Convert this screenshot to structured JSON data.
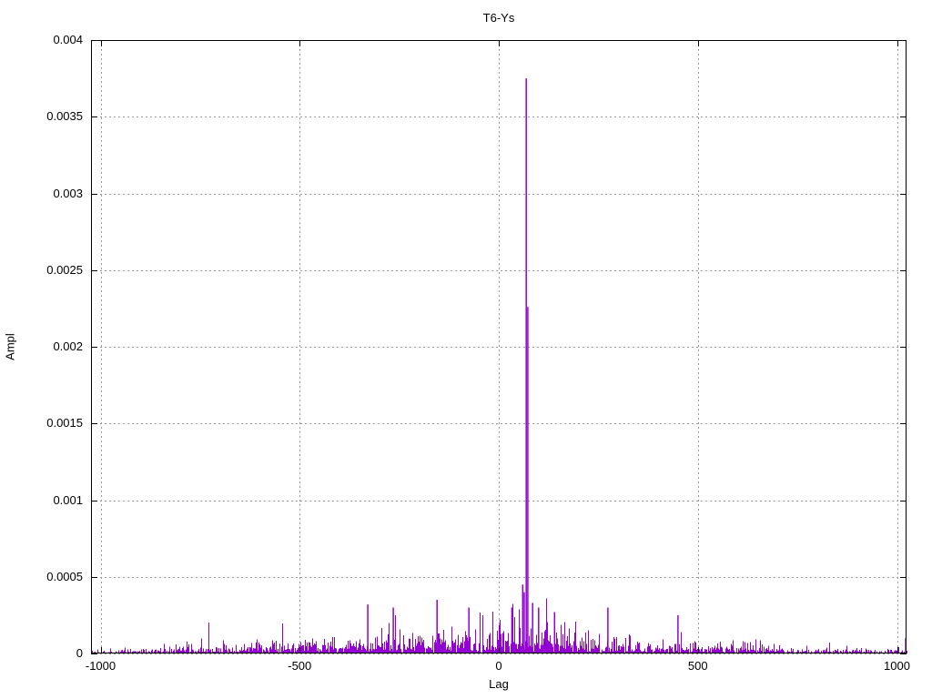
{
  "chart_data": {
    "type": "line",
    "style": "impulses",
    "title": "T6-Ys",
    "xlabel": "Lag",
    "ylabel": "Ampl",
    "xlim": [
      -1024,
      1024
    ],
    "ylim": [
      0,
      0.004
    ],
    "grid": true,
    "legend": "none",
    "series_color": "#9400d3",
    "grid_color": "#999999",
    "border_color": "#000000",
    "xticks": {
      "values": [
        -1000,
        -500,
        0,
        500,
        1000
      ],
      "labels": [
        "-1000",
        "-500",
        "0",
        "500",
        "1000"
      ]
    },
    "yticks": {
      "values": [
        0,
        0.0005,
        0.001,
        0.0015,
        0.002,
        0.0025,
        0.003,
        0.0035,
        0.004
      ],
      "labels": [
        "0",
        "0.0005",
        "0.001",
        "0.0015",
        "0.002",
        "0.0025",
        "0.003",
        "0.0035",
        "0.004"
      ]
    },
    "peaks": [
      {
        "lag": 69,
        "value": 0.00375
      },
      {
        "lag": 73,
        "value": 0.00226
      },
      {
        "lag": 60,
        "value": 0.00045
      },
      {
        "lag": 64,
        "value": 0.0004
      },
      {
        "lag": 33,
        "value": 0.0003
      },
      {
        "lag": 85,
        "value": 0.00033
      },
      {
        "lag": 100,
        "value": 0.0003
      },
      {
        "lag": 140,
        "value": 0.00027
      },
      {
        "lag": -75,
        "value": 0.0003
      },
      {
        "lag": -155,
        "value": 0.00035
      },
      {
        "lag": -265,
        "value": 0.0003
      },
      {
        "lag": -329,
        "value": 0.00032
      },
      {
        "lag": 274,
        "value": 0.0003
      },
      {
        "lag": 450,
        "value": 0.00025
      },
      {
        "lag": 1022,
        "value": 0.0001
      }
    ],
    "noise_model": {
      "seed": 1337,
      "lag_min": -1024,
      "lag_max": 1024,
      "step": 1,
      "mean_base": 1.6e-05,
      "mean_peak": 6.2e-05,
      "envelope_power": 1.25,
      "left_bias": 1.12,
      "center_bump_lag": 69,
      "center_bump_amp": 4e-05,
      "center_bump_sigma": 80,
      "cap": 0.00036
    }
  }
}
